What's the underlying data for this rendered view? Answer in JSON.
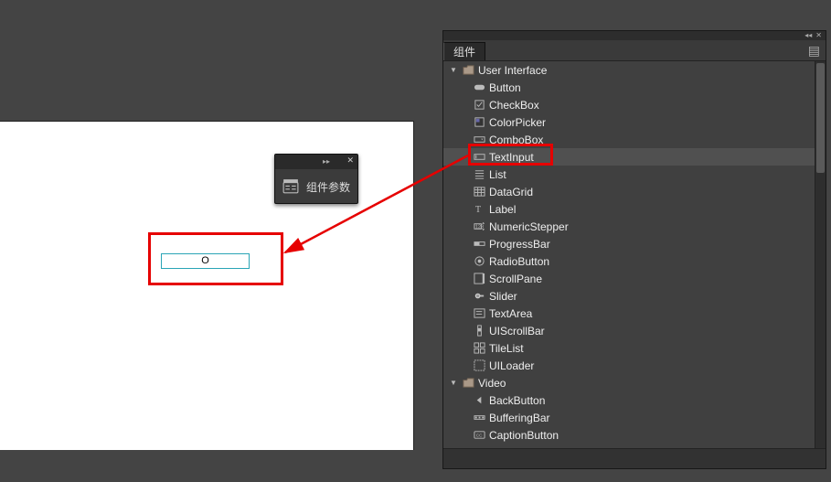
{
  "panel": {
    "title": "组件"
  },
  "params_panel": {
    "label": "组件参数"
  },
  "stage": {
    "dropped_component_marker": "O"
  },
  "tree": [
    {
      "kind": "folder",
      "disclose": "open",
      "label": "User Interface",
      "depth": 1
    },
    {
      "kind": "item",
      "icon": "button",
      "label": "Button",
      "depth": 2
    },
    {
      "kind": "item",
      "icon": "checkbox",
      "label": "CheckBox",
      "depth": 2
    },
    {
      "kind": "item",
      "icon": "colorpicker",
      "label": "ColorPicker",
      "depth": 2
    },
    {
      "kind": "item",
      "icon": "combobox",
      "label": "ComboBox",
      "depth": 2
    },
    {
      "kind": "item",
      "icon": "textinput",
      "label": "TextInput",
      "depth": 2,
      "selected": true
    },
    {
      "kind": "item",
      "icon": "list",
      "label": "List",
      "depth": 2
    },
    {
      "kind": "item",
      "icon": "datagrid",
      "label": "DataGrid",
      "depth": 2
    },
    {
      "kind": "item",
      "icon": "label",
      "label": "Label",
      "depth": 2
    },
    {
      "kind": "item",
      "icon": "stepper",
      "label": "NumericStepper",
      "depth": 2
    },
    {
      "kind": "item",
      "icon": "progress",
      "label": "ProgressBar",
      "depth": 2
    },
    {
      "kind": "item",
      "icon": "radio",
      "label": "RadioButton",
      "depth": 2
    },
    {
      "kind": "item",
      "icon": "scrollpane",
      "label": "ScrollPane",
      "depth": 2
    },
    {
      "kind": "item",
      "icon": "slider",
      "label": "Slider",
      "depth": 2
    },
    {
      "kind": "item",
      "icon": "textarea",
      "label": "TextArea",
      "depth": 2
    },
    {
      "kind": "item",
      "icon": "uiscrollbar",
      "label": "UIScrollBar",
      "depth": 2
    },
    {
      "kind": "item",
      "icon": "tilelist",
      "label": "TileList",
      "depth": 2
    },
    {
      "kind": "item",
      "icon": "uiloader",
      "label": "UILoader",
      "depth": 2
    },
    {
      "kind": "folder",
      "disclose": "open",
      "label": "Video",
      "depth": 1
    },
    {
      "kind": "item",
      "icon": "backbutton",
      "label": "BackButton",
      "depth": 2
    },
    {
      "kind": "item",
      "icon": "buffering",
      "label": "BufferingBar",
      "depth": 2
    },
    {
      "kind": "item",
      "icon": "caption",
      "label": "CaptionButton",
      "depth": 2
    }
  ]
}
